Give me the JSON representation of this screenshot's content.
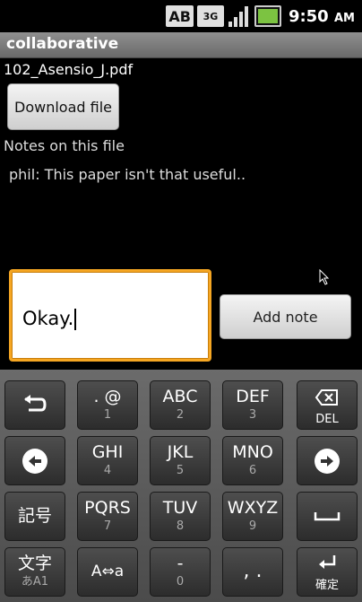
{
  "status_bar": {
    "ime_mode": "AB",
    "network": "3G",
    "time": "9:50",
    "ampm": "AM",
    "icons": [
      "ime-ab-icon",
      "network-3g-icon",
      "signal-icon",
      "battery-charging-icon"
    ]
  },
  "app": {
    "title": "collaborative"
  },
  "file": {
    "name": "102_Asensio_J.pdf",
    "download_label": "Download file"
  },
  "notes": {
    "label": "Notes on this file",
    "items": [
      "phil: This paper isn't that useful.."
    ]
  },
  "compose": {
    "value": "Okay.",
    "add_label": "Add note"
  },
  "keyboard": {
    "row1": [
      {
        "name": "back-key",
        "icon": "undo-arrow-icon"
      },
      {
        "name": "key-1",
        "main": ". @",
        "sub": "1"
      },
      {
        "name": "key-2",
        "main": "ABC",
        "sub": "2"
      },
      {
        "name": "key-3",
        "main": "DEF",
        "sub": "3"
      },
      {
        "name": "del-key",
        "icon": "backspace-icon",
        "sub": "DEL"
      }
    ],
    "row2": [
      {
        "name": "left-key",
        "icon": "left-arrow-icon"
      },
      {
        "name": "key-4",
        "main": "GHI",
        "sub": "4"
      },
      {
        "name": "key-5",
        "main": "JKL",
        "sub": "5"
      },
      {
        "name": "key-6",
        "main": "MNO",
        "sub": "6"
      },
      {
        "name": "right-key",
        "icon": "right-arrow-icon"
      }
    ],
    "row3": [
      {
        "name": "symbol-key",
        "main": "記号"
      },
      {
        "name": "key-7",
        "main": "PQRS",
        "sub": "7"
      },
      {
        "name": "key-8",
        "main": "TUV",
        "sub": "8"
      },
      {
        "name": "key-9",
        "main": "WXYZ",
        "sub": "9"
      },
      {
        "name": "space-key",
        "icon": "space-icon"
      }
    ],
    "row4": [
      {
        "name": "mode-key",
        "main": "文字",
        "sub": "あA1"
      },
      {
        "name": "case-key",
        "main": "A⇔a"
      },
      {
        "name": "key-0",
        "main": "-",
        "sub": "0"
      },
      {
        "name": "punct-key",
        "main": ",  ."
      },
      {
        "name": "enter-key",
        "icon": "enter-icon",
        "sub": "確定"
      }
    ]
  },
  "colors": {
    "focus_border": "#f5a623",
    "background": "#000000"
  }
}
